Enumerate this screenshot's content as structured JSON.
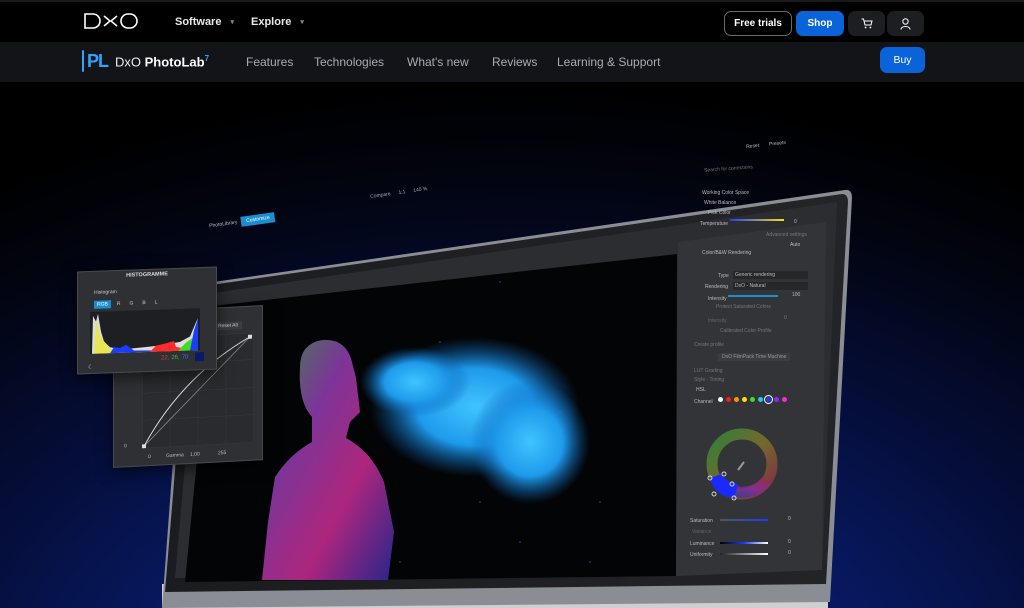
{
  "topbar": {
    "logo_text": "DXO",
    "nav": [
      {
        "label": "Software"
      },
      {
        "label": "Explore"
      }
    ],
    "free_trials_label": "Free trials",
    "shop_label": "Shop",
    "cart_icon": "cart-icon",
    "account_icon": "user-icon"
  },
  "subbar": {
    "product_badge": "PL",
    "product_brand": "DxO",
    "product_name": "PhotoLab",
    "product_version": "7",
    "nav": [
      {
        "label": "Features"
      },
      {
        "label": "Technologies"
      },
      {
        "label": "What's new"
      },
      {
        "label": "Reviews"
      },
      {
        "label": "Learning & Support"
      }
    ],
    "buy_label": "Buy"
  },
  "app": {
    "tabs": [
      {
        "label": "PhotoLibrary",
        "active": false
      },
      {
        "label": "Customize",
        "active": true
      }
    ],
    "toolbar": {
      "compare_label": "Compare",
      "ratio_label": "1:1",
      "zoom_label": "140 %"
    },
    "panel": {
      "reset_label": "Reset",
      "presets_label": "Presets",
      "search_placeholder": "Search for corrections",
      "sections": {
        "working_color_space": "Working Color Space",
        "white_balance": "White Balance",
        "pick_color": "Pick Color",
        "temperature": "Temperature",
        "temperature_value": "0",
        "advanced_settings": "Advanced settings",
        "auto": "Auto",
        "color_rendering": "Color/B&W Rendering",
        "type_label": "Type",
        "type_value": "Generic rendering",
        "rendering_label": "Rendering",
        "rendering_value": "DxO - Natural",
        "intensity_label": "Intensity",
        "intensity_value": "100",
        "protect_saturated": "Protect Saturated Colors",
        "protect_intensity_label": "Intensity",
        "protect_intensity_value": "0",
        "calibrated_profile": "Calibrated Color Profile",
        "create_profile": "Create profile",
        "filmpack": "DxO FilmPack Time Machine",
        "lut_grading": "LUT Grading",
        "style_toning": "Style - Toning",
        "hsl": "HSL",
        "channel_label": "Channel",
        "channels": [
          "#ffffff",
          "#ff1b1b",
          "#ff9500",
          "#ffe000",
          "#3fdc1f",
          "#14d3e6",
          "#1a3cff",
          "#8b2cff",
          "#ff2ccf"
        ],
        "selected_channel_index": 6,
        "saturation_label": "Saturation",
        "saturation_value": "0",
        "variance_label": "Variance",
        "luminance_label": "Luminance",
        "luminance_value": "0",
        "uniformity_label": "Uniformity",
        "uniformity_value": "0"
      }
    },
    "histogram": {
      "title": "HISTOGRAMME",
      "label": "Histogram",
      "channels": [
        "RGB",
        "R",
        "G",
        "B",
        "L"
      ],
      "active_channel": "RGB",
      "readout_r": "22,",
      "readout_g": "26,",
      "readout_b": "70"
    },
    "tone_curve": {
      "reset_label": "Reset All",
      "input_low": "0",
      "output_low": "0",
      "gamma_label": "Gamma",
      "gamma_value": "1,00",
      "output_high": "255"
    }
  }
}
